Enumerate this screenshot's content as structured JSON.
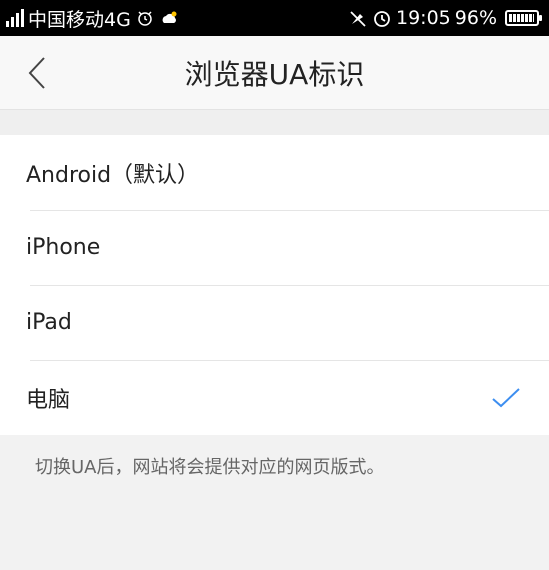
{
  "status_bar": {
    "carrier": "中国移动4G",
    "time": "19:05",
    "battery": "96%",
    "battery_level": 0.96,
    "icons": [
      "signal-icon",
      "alarm-clock-icon",
      "weather-icon",
      "mute-icon",
      "clock-icon",
      "battery-icon"
    ]
  },
  "header": {
    "title": "浏览器UA标识",
    "back_icon": "chevron-left-icon"
  },
  "options": [
    {
      "label": "Android（默认）",
      "selected": false
    },
    {
      "label": "iPhone",
      "selected": false
    },
    {
      "label": "iPad",
      "selected": false
    },
    {
      "label": "电脑",
      "selected": true
    }
  ],
  "footer_note": "切换UA后，网站将会提供对应的网页版式。",
  "colors": {
    "accent": "#3d8ef0",
    "status_bar_bg": "#000000",
    "page_bg": "#f2f2f2"
  }
}
